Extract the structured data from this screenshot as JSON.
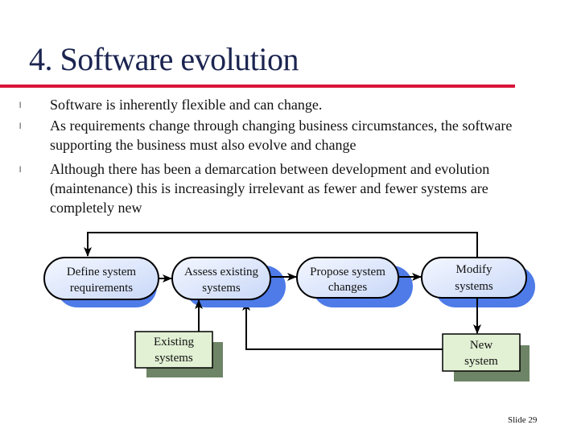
{
  "slide": {
    "title": "4. Software evolution",
    "bullets": [
      {
        "lines": [
          "Software is inherently flexible and can change."
        ]
      },
      {
        "lines": [
          "As requirements change through changing business circumstances, the software",
          "supporting the business must also evolve and change"
        ]
      },
      {
        "lines": [
          "Although there has been a demarcation between development and evolution",
          "(maintenance) this is increasingly irrelevant as fewer and fewer systems are",
          "completely new"
        ]
      }
    ],
    "bullet_glyph": "l",
    "footer": "Slide  29"
  },
  "diagram": {
    "process_nodes": [
      {
        "id": "define",
        "lines": [
          "Define system",
          "requirements"
        ]
      },
      {
        "id": "assess",
        "lines": [
          "Assess existing",
          "systems"
        ]
      },
      {
        "id": "propose",
        "lines": [
          "Propose system",
          "changes"
        ]
      },
      {
        "id": "modify",
        "lines": [
          "Modify",
          "systems"
        ]
      }
    ],
    "data_nodes": [
      {
        "id": "existing",
        "lines": [
          "Existing",
          "systems"
        ]
      },
      {
        "id": "new",
        "lines": [
          "New",
          "system"
        ]
      }
    ],
    "edges": [
      {
        "from": "define",
        "to": "assess"
      },
      {
        "from": "assess",
        "to": "propose"
      },
      {
        "from": "propose",
        "to": "modify"
      },
      {
        "from": "modify",
        "to": "define",
        "note": "feedback loop over top"
      },
      {
        "from": "modify",
        "to": "new"
      },
      {
        "from": "existing",
        "to": "assess"
      },
      {
        "from": "new",
        "to": "assess"
      }
    ],
    "colors": {
      "process_fill": "#dfe8fb",
      "process_shadow": "#4e7be8",
      "data_fill": "#e2f1d4",
      "data_shadow": "#6e8466",
      "stroke": "#000000"
    }
  }
}
